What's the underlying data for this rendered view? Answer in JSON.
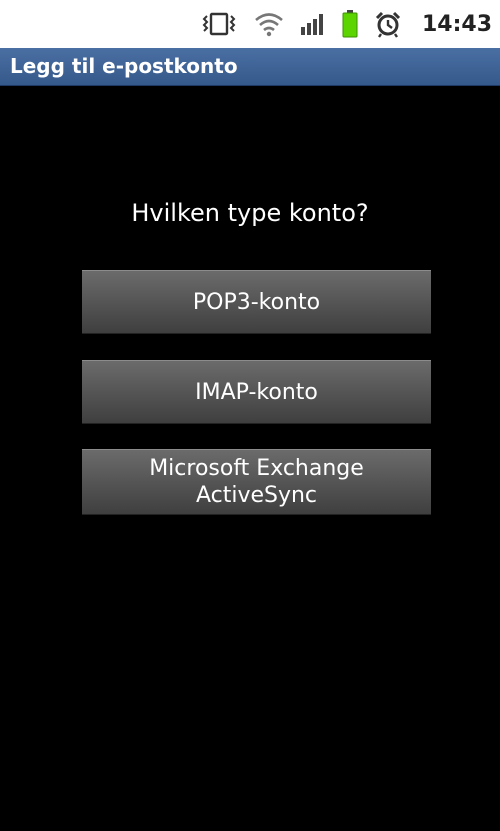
{
  "status_bar": {
    "time": "14:43",
    "icons": [
      "vibrate-icon",
      "wifi-icon",
      "signal-icon",
      "battery-icon",
      "alarm-icon"
    ],
    "battery_color": "#5bd400"
  },
  "title_bar": {
    "title": "Legg til e-postkonto",
    "color": "#3d6396"
  },
  "main": {
    "question": "Hvilken type konto?",
    "buttons": [
      {
        "label": "POP3-konto"
      },
      {
        "label": "IMAP-konto"
      },
      {
        "label": "Microsoft Exchange\nActiveSync"
      }
    ]
  }
}
